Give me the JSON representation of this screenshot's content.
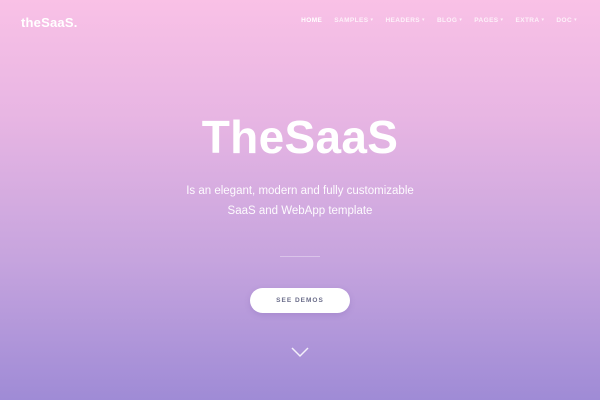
{
  "brand": {
    "logo": "theSaaS."
  },
  "nav": {
    "items": [
      {
        "label": "HOME",
        "caret": ""
      },
      {
        "label": "SAMPLES",
        "caret": "▾"
      },
      {
        "label": "HEADERS",
        "caret": "▾"
      },
      {
        "label": "BLOG",
        "caret": "▾"
      },
      {
        "label": "PAGES",
        "caret": "▾"
      },
      {
        "label": "EXTRA",
        "caret": "▾"
      },
      {
        "label": "DOC",
        "caret": "▾"
      }
    ]
  },
  "hero": {
    "title": "TheSaaS",
    "subtitle_line1": "Is an elegant, modern and fully customizable",
    "subtitle_line2": "SaaS and WebApp template",
    "cta": "SEE DEMOS",
    "scroll_icon": "chevron-down-icon"
  },
  "colors": {
    "gradient_top": "#f9c1e6",
    "gradient_bottom": "#9f8bd6",
    "button_text": "#6b6d8a"
  }
}
